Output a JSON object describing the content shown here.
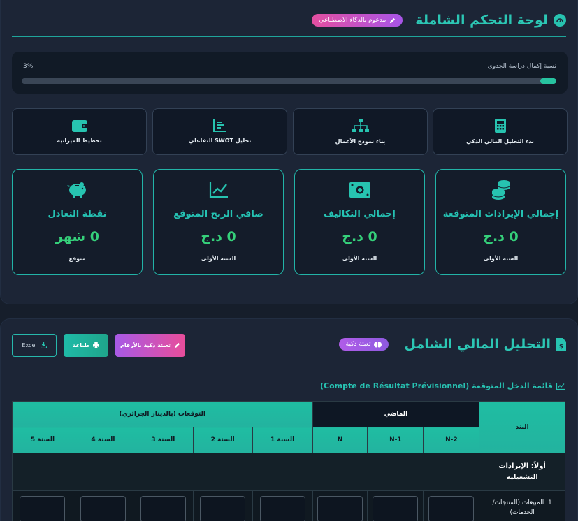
{
  "dashboard": {
    "title": "لوحة التحكم الشاملة",
    "ai_badge": "مدعوم بالذكاء الاصطناعي",
    "progress": {
      "label": "نسبة إكمال دراسة الجدوى",
      "percent_text": "3%",
      "fraction": 0.03
    },
    "quick_actions": [
      {
        "label": "بدء التحليل المالي الذكي",
        "icon": "calculator-icon"
      },
      {
        "label": "بناء نموذج الأعمال",
        "icon": "sitemap-icon"
      },
      {
        "label": "تحليل SWOT التفاعلي",
        "icon": "list-chart-icon"
      },
      {
        "label": "تخطيط الميزانية",
        "icon": "wallet-icon"
      }
    ],
    "stats": [
      {
        "title": "إجمالي الإيرادات المتوقعة",
        "value": "0 د.ج",
        "sub": "السنة الأولى",
        "icon": "coins-icon"
      },
      {
        "title": "إجمالي التكاليف",
        "value": "0 د.ج",
        "sub": "السنة الأولى",
        "icon": "money-bill-icon"
      },
      {
        "title": "صافي الربح المتوقع",
        "value": "0 د.ج",
        "sub": "السنة الأولى",
        "icon": "line-chart-icon"
      },
      {
        "title": "نقطة التعادل",
        "value": "0 شهر",
        "sub": "متوقع",
        "icon": "piggy-bank-icon"
      }
    ]
  },
  "financial": {
    "title": "التحليل المالي الشامل",
    "smart_badge": "تعبئة ذكية",
    "buttons": {
      "fill": "تعبئة ذكية بالأرقام",
      "print": "طباعة",
      "excel": "Excel"
    },
    "income_title": "قائمة الدخل المتوقعة (Compte de Résultat Prévisionnel)",
    "table": {
      "item_header": "البند",
      "past_header": "الماضي",
      "forecast_header": "التوقعات (بالدينار الجزائري)",
      "past_cols": [
        "N-2",
        "N-1",
        "N"
      ],
      "forecast_cols": [
        "السنة 1",
        "السنة 2",
        "السنة 3",
        "السنة 4",
        "السنة 5"
      ],
      "section_label": "أولاً: الإيرادات التشغيلية",
      "first_row_label": "1. المبيعات (المنتجات/الخدمات)"
    }
  },
  "colors": {
    "accent": "#2cc6b4",
    "value_green": "#35d07a",
    "pink": "#e34fa0",
    "purple": "#a855e8"
  }
}
